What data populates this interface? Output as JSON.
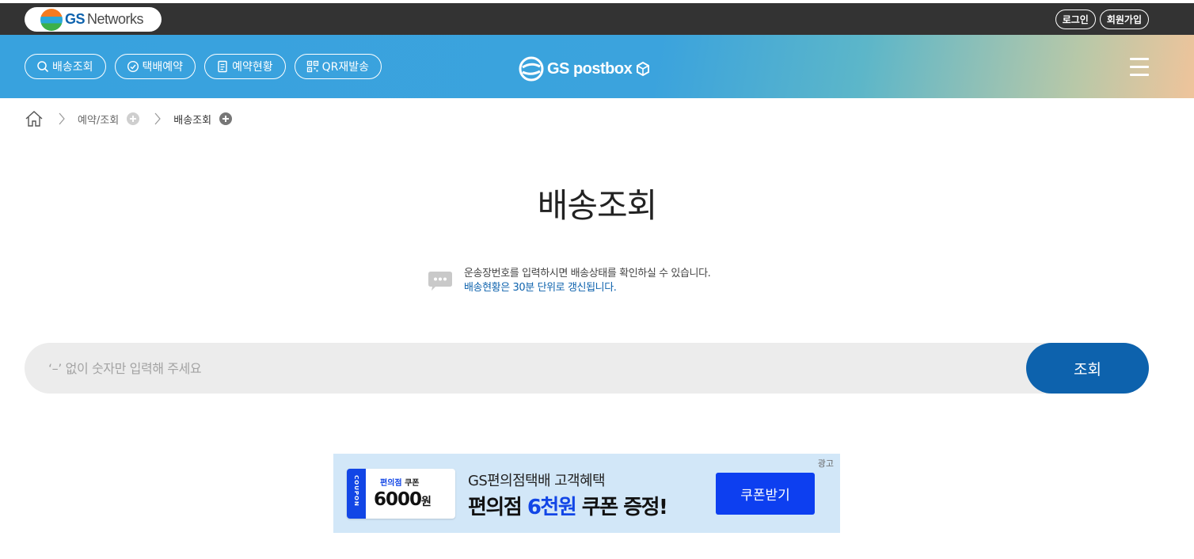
{
  "top_bar": {
    "logo_gs": "GS",
    "logo_networks": "Networks",
    "login_label": "로그인",
    "signup_label": "회원가입"
  },
  "nav": {
    "items": [
      {
        "label": "배송조회",
        "icon": "search-icon"
      },
      {
        "label": "택배예약",
        "icon": "clock-icon"
      },
      {
        "label": "예약현황",
        "icon": "document-icon"
      },
      {
        "label": "QR재발송",
        "icon": "qr-icon"
      }
    ],
    "brand_text": "GS postbox",
    "menu_icon": "hamburger-icon"
  },
  "breadcrumb": {
    "home_icon": "home-icon",
    "items": [
      "예약/조회",
      "배송조회"
    ]
  },
  "page": {
    "title": "배송조회",
    "notice_line1": "운송장번호를 입력하시면 배송상태를 확인하실 수 있습니다.",
    "notice_line2": "배송현황은 30분 단위로 갱신됩니다."
  },
  "search": {
    "placeholder": "‘–’ 없이 숫자만 입력해 주세요",
    "value": "",
    "button_label": "조회"
  },
  "ad": {
    "label": "광고",
    "coupon_side": "COUPON",
    "coupon_top_blue": "편의점",
    "coupon_top_dark": "쿠폰",
    "coupon_amount": "6000",
    "coupon_unit": "원",
    "subtitle": "GS편의점택배 고객혜택",
    "main_pre": "편의점 ",
    "main_highlight": "6천원",
    "main_post": " 쿠폰 증정!",
    "button_label": "쿠폰받기"
  },
  "colors": {
    "primary": "#0d62ad",
    "top_bar": "#333333",
    "gnb_start": "#38a2de",
    "gnb_end": "#efc49b",
    "search_bg": "#ececec",
    "ad_bg": "#d2e7f8",
    "ad_button": "#0d3ff0"
  }
}
